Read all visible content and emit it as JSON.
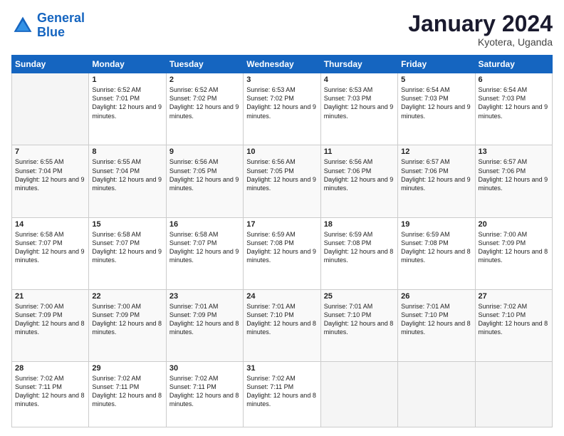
{
  "header": {
    "logo_line1": "General",
    "logo_line2": "Blue",
    "title": "January 2024",
    "subtitle": "Kyotera, Uganda"
  },
  "days_of_week": [
    "Sunday",
    "Monday",
    "Tuesday",
    "Wednesday",
    "Thursday",
    "Friday",
    "Saturday"
  ],
  "weeks": [
    [
      {
        "num": "",
        "empty": true
      },
      {
        "num": "1",
        "sunrise": "6:52 AM",
        "sunset": "7:01 PM",
        "daylight": "12 hours and 9 minutes."
      },
      {
        "num": "2",
        "sunrise": "6:52 AM",
        "sunset": "7:02 PM",
        "daylight": "12 hours and 9 minutes."
      },
      {
        "num": "3",
        "sunrise": "6:53 AM",
        "sunset": "7:02 PM",
        "daylight": "12 hours and 9 minutes."
      },
      {
        "num": "4",
        "sunrise": "6:53 AM",
        "sunset": "7:03 PM",
        "daylight": "12 hours and 9 minutes."
      },
      {
        "num": "5",
        "sunrise": "6:54 AM",
        "sunset": "7:03 PM",
        "daylight": "12 hours and 9 minutes."
      },
      {
        "num": "6",
        "sunrise": "6:54 AM",
        "sunset": "7:03 PM",
        "daylight": "12 hours and 9 minutes."
      }
    ],
    [
      {
        "num": "7",
        "sunrise": "6:55 AM",
        "sunset": "7:04 PM",
        "daylight": "12 hours and 9 minutes."
      },
      {
        "num": "8",
        "sunrise": "6:55 AM",
        "sunset": "7:04 PM",
        "daylight": "12 hours and 9 minutes."
      },
      {
        "num": "9",
        "sunrise": "6:56 AM",
        "sunset": "7:05 PM",
        "daylight": "12 hours and 9 minutes."
      },
      {
        "num": "10",
        "sunrise": "6:56 AM",
        "sunset": "7:05 PM",
        "daylight": "12 hours and 9 minutes."
      },
      {
        "num": "11",
        "sunrise": "6:56 AM",
        "sunset": "7:06 PM",
        "daylight": "12 hours and 9 minutes."
      },
      {
        "num": "12",
        "sunrise": "6:57 AM",
        "sunset": "7:06 PM",
        "daylight": "12 hours and 9 minutes."
      },
      {
        "num": "13",
        "sunrise": "6:57 AM",
        "sunset": "7:06 PM",
        "daylight": "12 hours and 9 minutes."
      }
    ],
    [
      {
        "num": "14",
        "sunrise": "6:58 AM",
        "sunset": "7:07 PM",
        "daylight": "12 hours and 9 minutes."
      },
      {
        "num": "15",
        "sunrise": "6:58 AM",
        "sunset": "7:07 PM",
        "daylight": "12 hours and 9 minutes."
      },
      {
        "num": "16",
        "sunrise": "6:58 AM",
        "sunset": "7:07 PM",
        "daylight": "12 hours and 9 minutes."
      },
      {
        "num": "17",
        "sunrise": "6:59 AM",
        "sunset": "7:08 PM",
        "daylight": "12 hours and 9 minutes."
      },
      {
        "num": "18",
        "sunrise": "6:59 AM",
        "sunset": "7:08 PM",
        "daylight": "12 hours and 8 minutes."
      },
      {
        "num": "19",
        "sunrise": "6:59 AM",
        "sunset": "7:08 PM",
        "daylight": "12 hours and 8 minutes."
      },
      {
        "num": "20",
        "sunrise": "7:00 AM",
        "sunset": "7:09 PM",
        "daylight": "12 hours and 8 minutes."
      }
    ],
    [
      {
        "num": "21",
        "sunrise": "7:00 AM",
        "sunset": "7:09 PM",
        "daylight": "12 hours and 8 minutes."
      },
      {
        "num": "22",
        "sunrise": "7:00 AM",
        "sunset": "7:09 PM",
        "daylight": "12 hours and 8 minutes."
      },
      {
        "num": "23",
        "sunrise": "7:01 AM",
        "sunset": "7:09 PM",
        "daylight": "12 hours and 8 minutes."
      },
      {
        "num": "24",
        "sunrise": "7:01 AM",
        "sunset": "7:10 PM",
        "daylight": "12 hours and 8 minutes."
      },
      {
        "num": "25",
        "sunrise": "7:01 AM",
        "sunset": "7:10 PM",
        "daylight": "12 hours and 8 minutes."
      },
      {
        "num": "26",
        "sunrise": "7:01 AM",
        "sunset": "7:10 PM",
        "daylight": "12 hours and 8 minutes."
      },
      {
        "num": "27",
        "sunrise": "7:02 AM",
        "sunset": "7:10 PM",
        "daylight": "12 hours and 8 minutes."
      }
    ],
    [
      {
        "num": "28",
        "sunrise": "7:02 AM",
        "sunset": "7:11 PM",
        "daylight": "12 hours and 8 minutes."
      },
      {
        "num": "29",
        "sunrise": "7:02 AM",
        "sunset": "7:11 PM",
        "daylight": "12 hours and 8 minutes."
      },
      {
        "num": "30",
        "sunrise": "7:02 AM",
        "sunset": "7:11 PM",
        "daylight": "12 hours and 8 minutes."
      },
      {
        "num": "31",
        "sunrise": "7:02 AM",
        "sunset": "7:11 PM",
        "daylight": "12 hours and 8 minutes."
      },
      {
        "num": "",
        "empty": true
      },
      {
        "num": "",
        "empty": true
      },
      {
        "num": "",
        "empty": true
      }
    ]
  ]
}
